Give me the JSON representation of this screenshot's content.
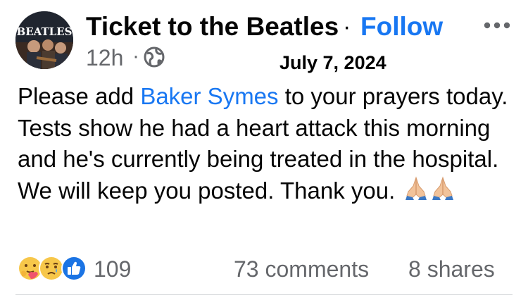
{
  "post": {
    "page_name": "Ticket to the Beatles",
    "separator": "·",
    "follow_label": "Follow",
    "timestamp": "12h",
    "time_separator": "·",
    "date_stamp": "July 7, 2024",
    "audience_icon": "globe-icon",
    "more_icon": "more-options-icon",
    "avatar_logo_text": "BEATLES",
    "body": {
      "prefix": "Please add ",
      "mention": "Baker Symes",
      "suffix": " to your prayers today. Tests show he had a heart attack this morning and he's currently being treated in the hospital. We will keep you posted.  Thank you.",
      "emojis": [
        "folded-hands-emoji",
        "folded-hands-emoji"
      ]
    },
    "reactions": {
      "icons": [
        "care-reaction-icon",
        "sad-reaction-icon",
        "like-reaction-icon"
      ],
      "count": "109"
    },
    "comments_label": "73 comments",
    "shares_label": "8 shares"
  },
  "colors": {
    "link_blue": "#1877f2",
    "secondary_text": "#65676b",
    "primary_text": "#050505",
    "divider": "#ced0d4"
  }
}
